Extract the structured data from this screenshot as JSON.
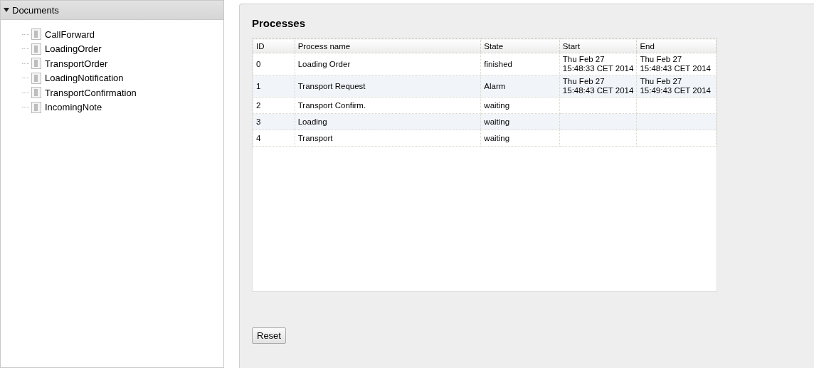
{
  "sidebar": {
    "title": "Documents",
    "expanded": true,
    "items": [
      {
        "label": "CallForward"
      },
      {
        "label": "LoadingOrder"
      },
      {
        "label": "TransportOrder"
      },
      {
        "label": "LoadingNotification"
      },
      {
        "label": "TransportConfirmation"
      },
      {
        "label": "IncomingNote"
      }
    ]
  },
  "main": {
    "title": "Processes",
    "table": {
      "columns": [
        "ID",
        "Process name",
        "State",
        "Start",
        "End"
      ],
      "rows": [
        [
          "0",
          "Loading Order",
          "finished",
          "Thu Feb 27 15:48:33 CET 2014",
          "Thu Feb 27 15:48:43 CET 2014"
        ],
        [
          "1",
          "Transport Request",
          "Alarm",
          "Thu Feb 27 15:48:43 CET 2014",
          "Thu Feb 27 15:49:43 CET 2014"
        ],
        [
          "2",
          "Transport Confirm.",
          "waiting",
          "",
          ""
        ],
        [
          "3",
          "Loading",
          "waiting",
          "",
          ""
        ],
        [
          "4",
          "Transport",
          "waiting",
          "",
          ""
        ]
      ]
    },
    "buttons": [
      "Reset"
    ]
  }
}
